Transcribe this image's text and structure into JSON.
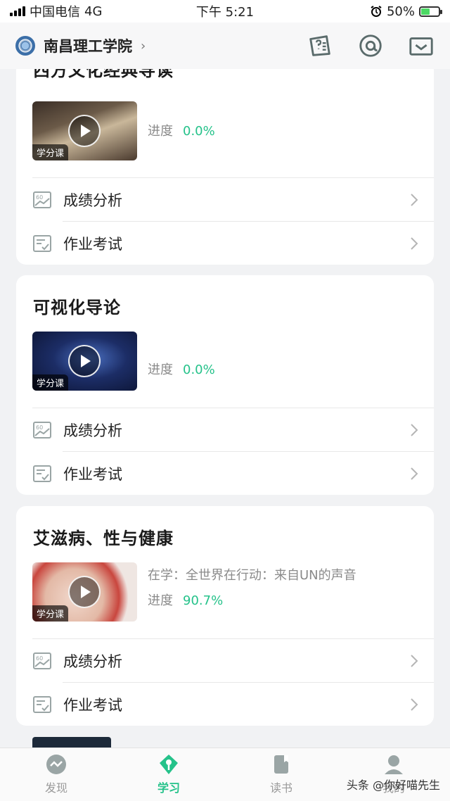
{
  "status_bar": {
    "carrier": "中国电信",
    "network": "4G",
    "time": "下午 5:21",
    "battery": "50%"
  },
  "header": {
    "school_name": "南昌理工学院",
    "icons": [
      "quiz-card-icon",
      "at-chat-icon",
      "mail-icon"
    ]
  },
  "courses": [
    {
      "title": "西方文化经典导读",
      "tag": "学分课",
      "studying": "",
      "progress_label": "进度",
      "progress": "0.0%",
      "rows": [
        "成绩分析",
        "作业考试"
      ]
    },
    {
      "title": "可视化导论",
      "tag": "学分课",
      "studying": "",
      "progress_label": "进度",
      "progress": "0.0%",
      "rows": [
        "成绩分析",
        "作业考试"
      ]
    },
    {
      "title": "艾滋病、性与健康",
      "tag": "学分课",
      "studying": "在学：全世界在行动：来自UN的声音",
      "progress_label": "进度",
      "progress": "90.7%",
      "rows": [
        "成绩分析",
        "作业考试"
      ]
    }
  ],
  "tabs": [
    {
      "label": "发现",
      "icon": "discover-icon"
    },
    {
      "label": "学习",
      "icon": "study-icon",
      "active": true
    },
    {
      "label": "读书",
      "icon": "book-icon"
    },
    {
      "label": "我的",
      "icon": "profile-icon"
    }
  ],
  "watermark": "头条 @你好喵先生",
  "colors": {
    "accent": "#25c28a",
    "text": "#1f1f1f",
    "muted": "#8a8a8a",
    "background": "#f1f2f4"
  }
}
